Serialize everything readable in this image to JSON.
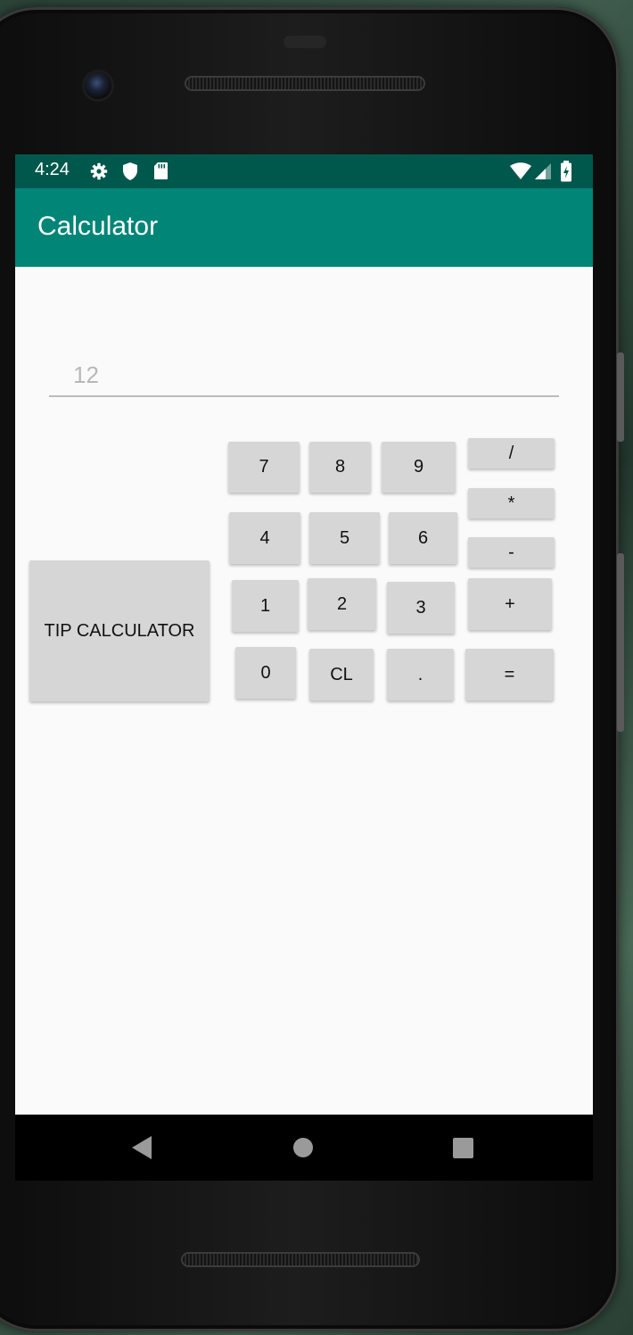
{
  "status_bar": {
    "time": "4:24",
    "left_icons": [
      "gear-icon",
      "shield-icon",
      "sd-card-icon"
    ],
    "right_icons": [
      "wifi-icon",
      "signal-icon",
      "battery-charging-icon"
    ]
  },
  "app_bar": {
    "title": "Calculator"
  },
  "display": {
    "value": "12"
  },
  "buttons": {
    "tip": "TIP CALCULATOR",
    "seven": "7",
    "eight": "8",
    "nine": "9",
    "four": "4",
    "five": "5",
    "six": "6",
    "one": "1",
    "two": "2",
    "three": "3",
    "zero": "0",
    "clear": "CL",
    "dot": ".",
    "divide": "/",
    "multiply": "*",
    "minus": "-",
    "plus": "+",
    "equals": "="
  },
  "nav_bar": {
    "icons": [
      "back-icon",
      "home-icon",
      "recents-icon"
    ]
  },
  "colors": {
    "status_bar": "#00574b",
    "app_bar": "#008577",
    "button": "#d6d6d6",
    "background": "#fafafa"
  }
}
